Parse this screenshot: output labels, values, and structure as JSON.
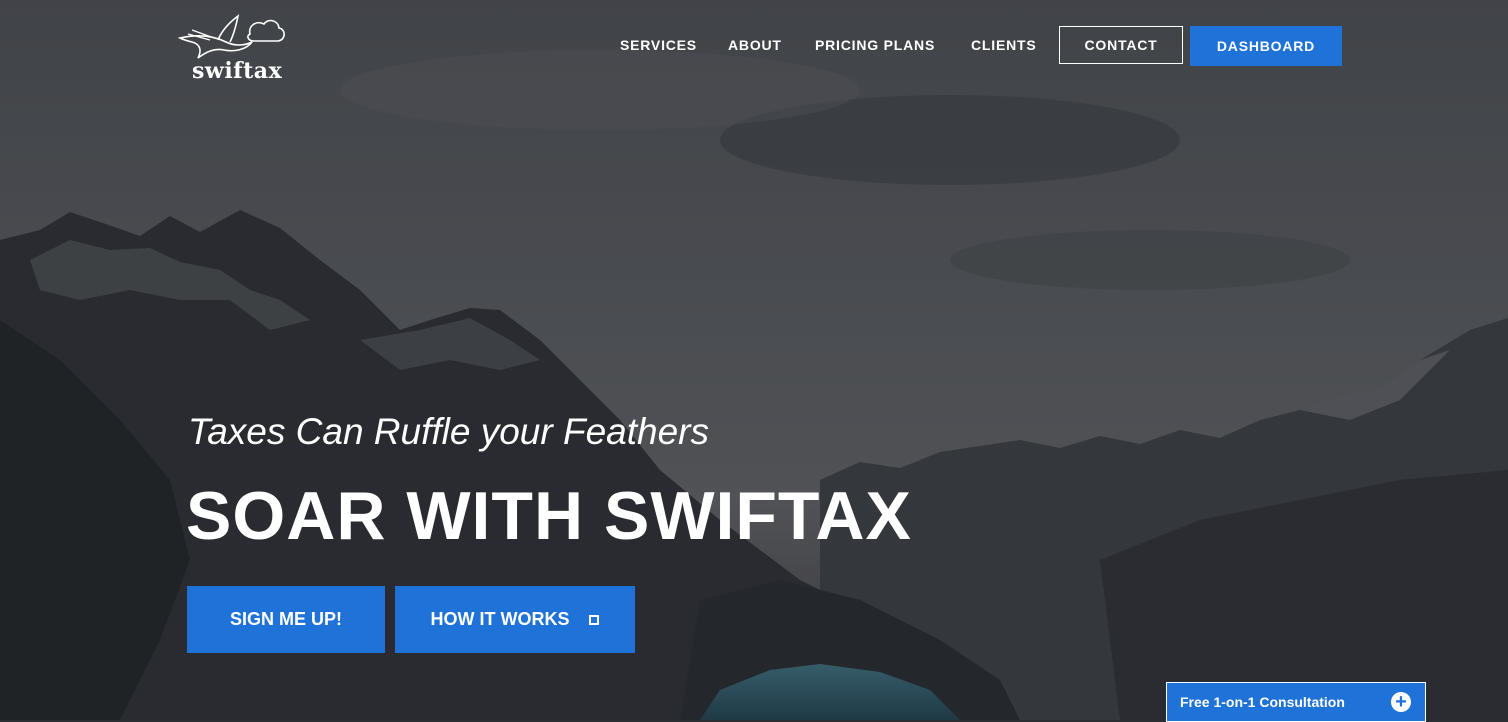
{
  "brand": {
    "name": "swiftax"
  },
  "nav": {
    "items": [
      {
        "label": "SERVICES"
      },
      {
        "label": "ABOUT"
      },
      {
        "label": "PRICING PLANS"
      },
      {
        "label": "CLIENTS"
      }
    ],
    "contact": "CONTACT",
    "dashboard": "DASHBOARD"
  },
  "hero": {
    "tagline": "Taxes Can Ruffle your Feathers",
    "headline": "SOAR WITH SWIFTAX",
    "primary_cta": "SIGN ME UP!",
    "secondary_cta": "HOW IT WORKS"
  },
  "consultation": {
    "label": "Free 1-on-1 Consultation",
    "icon": "plus-circle-icon"
  },
  "colors": {
    "accent": "#1e72d8",
    "text": "#ffffff",
    "overlay": "#2b2e33"
  }
}
